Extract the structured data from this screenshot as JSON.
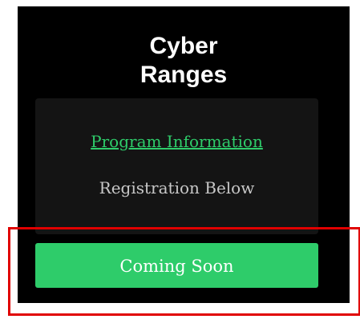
{
  "title": {
    "line1": "Cyber",
    "line2": "Ranges"
  },
  "card": {
    "program_link": "Program Information",
    "registration_text": "Registration Below"
  },
  "cta": {
    "label": "Coming Soon"
  },
  "colors": {
    "panel_bg": "#000000",
    "card_bg": "#141414",
    "accent_green": "#2ecc6a",
    "highlight_red": "#e00000"
  }
}
